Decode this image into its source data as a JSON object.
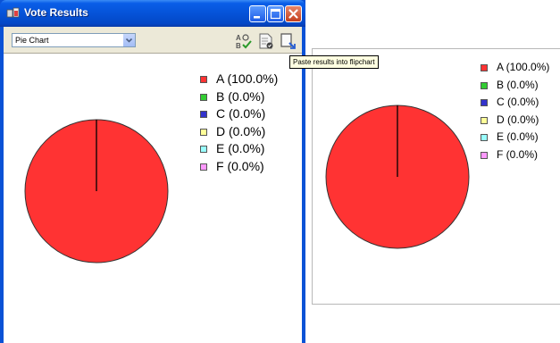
{
  "window": {
    "title": "Vote Results",
    "minimize_label": "Minimize",
    "maximize_label": "Maximize",
    "close_label": "Close"
  },
  "toolbar": {
    "chart_type_selected": "Pie Chart",
    "tools": [
      {
        "icon": "sort-ab-check-icon"
      },
      {
        "icon": "document-check-icon"
      },
      {
        "icon": "paste-to-flipchart-icon"
      }
    ]
  },
  "tooltip": {
    "text": "Paste results into flipchart"
  },
  "chart_data": [
    {
      "type": "pie",
      "categories": [
        "A",
        "B",
        "C",
        "D",
        "E",
        "F"
      ],
      "values": [
        100.0,
        0.0,
        0.0,
        0.0,
        0.0,
        0.0
      ],
      "legend": [
        "A (100.0%)",
        "B (0.0%)",
        "C (0.0%)",
        "D (0.0%)",
        "E (0.0%)",
        "F (0.0%)"
      ],
      "colors": [
        "#ff3333",
        "#33cc33",
        "#3333cc",
        "#ffff99",
        "#99ffff",
        "#ff99ff"
      ],
      "legend_position": "right"
    },
    {
      "type": "pie",
      "categories": [
        "A",
        "B",
        "C",
        "D",
        "E",
        "F"
      ],
      "values": [
        100.0,
        0.0,
        0.0,
        0.0,
        0.0,
        0.0
      ],
      "legend": [
        "A (100.0%)",
        "B (0.0%)",
        "C (0.0%)",
        "D (0.0%)",
        "E (0.0%)",
        "F (0.0%)"
      ],
      "colors": [
        "#ff3333",
        "#33cc33",
        "#3333cc",
        "#ffff99",
        "#99ffff",
        "#ff99ff"
      ],
      "legend_position": "right"
    }
  ]
}
